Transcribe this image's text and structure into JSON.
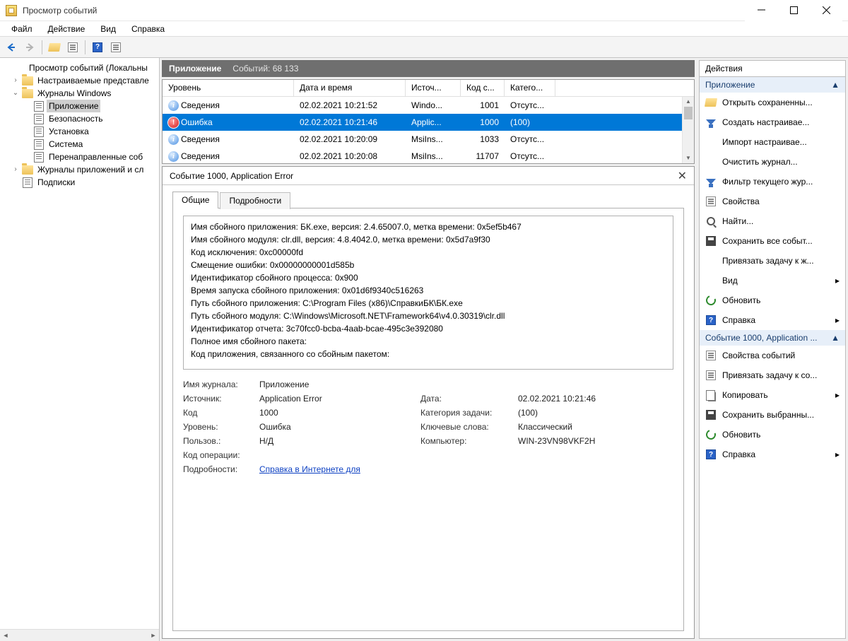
{
  "window": {
    "title": "Просмотр событий"
  },
  "menu": {
    "file": "Файл",
    "action": "Действие",
    "view": "Вид",
    "help": "Справка"
  },
  "tree": {
    "root": "Просмотр событий (Локальны",
    "custom": "Настраиваемые представле",
    "winlogs": "Журналы Windows",
    "app": "Приложение",
    "security": "Безопасность",
    "setup": "Установка",
    "system": "Система",
    "forwarded": "Перенаправленные соб",
    "appservlogs": "Журналы приложений и сл",
    "subs": "Подписки"
  },
  "listHeader": {
    "label": "Приложение",
    "count": "Событий: 68 133"
  },
  "columns": {
    "level": "Уровень",
    "datetime": "Дата и время",
    "source": "Источ...",
    "code": "Код с...",
    "cat": "Катего..."
  },
  "events": [
    {
      "lvl": "info",
      "lvlText": "Сведения",
      "dt": "02.02.2021 10:21:52",
      "src": "Windo...",
      "code": "1001",
      "cat": "Отсутс..."
    },
    {
      "lvl": "err",
      "lvlText": "Ошибка",
      "dt": "02.02.2021 10:21:46",
      "src": "Applic...",
      "code": "1000",
      "cat": "(100)",
      "sel": true
    },
    {
      "lvl": "info",
      "lvlText": "Сведения",
      "dt": "02.02.2021 10:20:09",
      "src": "MsiIns...",
      "code": "1033",
      "cat": "Отсутс..."
    },
    {
      "lvl": "info",
      "lvlText": "Сведения",
      "dt": "02.02.2021 10:20:08",
      "src": "MsiIns...",
      "code": "11707",
      "cat": "Отсутс..."
    }
  ],
  "detail": {
    "title": "Событие 1000, Application Error",
    "tabGeneral": "Общие",
    "tabDetails": "Подробности",
    "lines": [
      "Имя сбойного приложения: БК.exe, версия: 2.4.65007.0, метка времени: 0x5ef5b467",
      "Имя сбойного модуля: clr.dll, версия: 4.8.4042.0, метка времени: 0x5d7a9f30",
      "Код исключения: 0xc00000fd",
      "Смещение ошибки: 0x00000000001d585b",
      "Идентификатор сбойного процесса: 0x900",
      "Время запуска сбойного приложения: 0x01d6f9340c516263",
      "Путь сбойного приложения: C:\\Program Files (x86)\\СправкиБК\\БК.exe",
      "Путь сбойного модуля: C:\\Windows\\Microsoft.NET\\Framework64\\v4.0.30319\\clr.dll",
      "Идентификатор отчета: 3c70fcc0-bcba-4aab-bcae-495c3e392080",
      "Полное имя сбойного пакета:",
      "Код приложения, связанного со сбойным пакетом:"
    ],
    "fields": {
      "logName": {
        "l": "Имя журнала:",
        "v": "Приложение"
      },
      "source": {
        "l": "Источник:",
        "v": "Application Error"
      },
      "date": {
        "l": "Дата:",
        "v": "02.02.2021 10:21:46"
      },
      "code": {
        "l": "Код",
        "v": "1000"
      },
      "taskCat": {
        "l": "Категория задачи:",
        "v": "(100)"
      },
      "level": {
        "l": "Уровень:",
        "v": "Ошибка"
      },
      "keywords": {
        "l": "Ключевые слова:",
        "v": "Классический"
      },
      "user": {
        "l": "Пользов.:",
        "v": "Н/Д"
      },
      "computer": {
        "l": "Компьютер:",
        "v": "WIN-23VN98VKF2H"
      },
      "opcode": {
        "l": "Код операции:",
        "v": ""
      },
      "more": {
        "l": "Подробности:",
        "v": "Справка в Интернете для"
      }
    }
  },
  "actions": {
    "title": "Действия",
    "sectionApp": "Приложение",
    "open": "Открыть сохраненны...",
    "createView": "Создать настраивае...",
    "importView": "Импорт настраивае...",
    "clear": "Очистить журнал...",
    "filter": "Фильтр текущего жур...",
    "props": "Свойства",
    "find": "Найти...",
    "saveAll": "Сохранить все событ...",
    "attach": "Привязать задачу к ж...",
    "view": "Вид",
    "refresh": "Обновить",
    "help": "Справка",
    "sectionEvt": "Событие 1000, Application ...",
    "evtProps": "Свойства событий",
    "evtAttach": "Привязать задачу к со...",
    "copy": "Копировать",
    "saveSel": "Сохранить выбранны...",
    "refresh2": "Обновить",
    "help2": "Справка"
  }
}
